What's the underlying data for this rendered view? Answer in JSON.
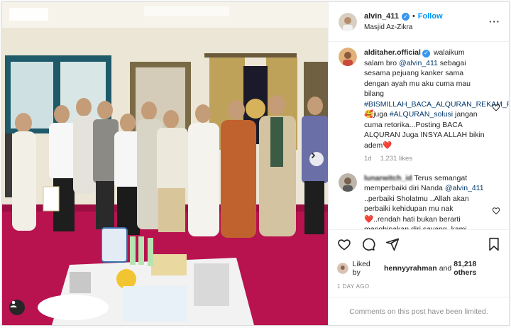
{
  "post": {
    "author": "alvin_411",
    "follow_label": "Follow",
    "location": "Masjid Az-Zikra",
    "separator": "•"
  },
  "comments": [
    {
      "user": "alditaher.official",
      "parts": [
        {
          "t": " walaikum salam bro ",
          "k": "text"
        },
        {
          "t": "@alvin_411",
          "k": "mention"
        },
        {
          "t": " sebagai sesama pejuang kanker sama dengan ayah mu aku cuma mau bilang ",
          "k": "text"
        },
        {
          "t": "#BISMILLAH_BACA_ALQURAN_REKAM_POSTING_juga",
          "k": "hashtag"
        },
        {
          "t": "🥰juga ",
          "k": "text"
        },
        {
          "t": "#ALQURAN_solusi",
          "k": "hashtag"
        },
        {
          "t": " jangan cuma retorika...Posting BACA ALQURAN Juga INSYA ALLAH bikin adem❤️",
          "k": "text"
        }
      ],
      "time": "1d",
      "likes": "1,231 likes"
    },
    {
      "user": "lunarwitch_id",
      "parts": [
        {
          "t": " Terus semangat memperbaiki diri Nanda ",
          "k": "text"
        },
        {
          "t": "@alvin_411",
          "k": "mention"
        },
        {
          "t": " ..perbaiki Sholatmu ..Allah akan perbaiki kehidupan mu nak❤️..rendah hati bukan berarti menghinakan diri sayang, kami semua",
          "k": "text"
        }
      ]
    }
  ],
  "likes": {
    "prefix": "Liked by ",
    "user": "hennyyrahman",
    "middle": " and ",
    "count": "81,218 others"
  },
  "timestamp": "1 DAY AGO",
  "comments_disabled": "Comments on this post have been limited.",
  "icons": [
    "heart-icon",
    "comment-icon",
    "share-icon",
    "bookmark-icon",
    "more-icon",
    "verified-icon",
    "next-arrow-icon",
    "tag-user-icon"
  ],
  "colors": {
    "accent": "#0095f6",
    "verified": "#3897f0",
    "carpet": "#b8124f",
    "mention": "#00376b",
    "muted": "#8e8e8e"
  }
}
